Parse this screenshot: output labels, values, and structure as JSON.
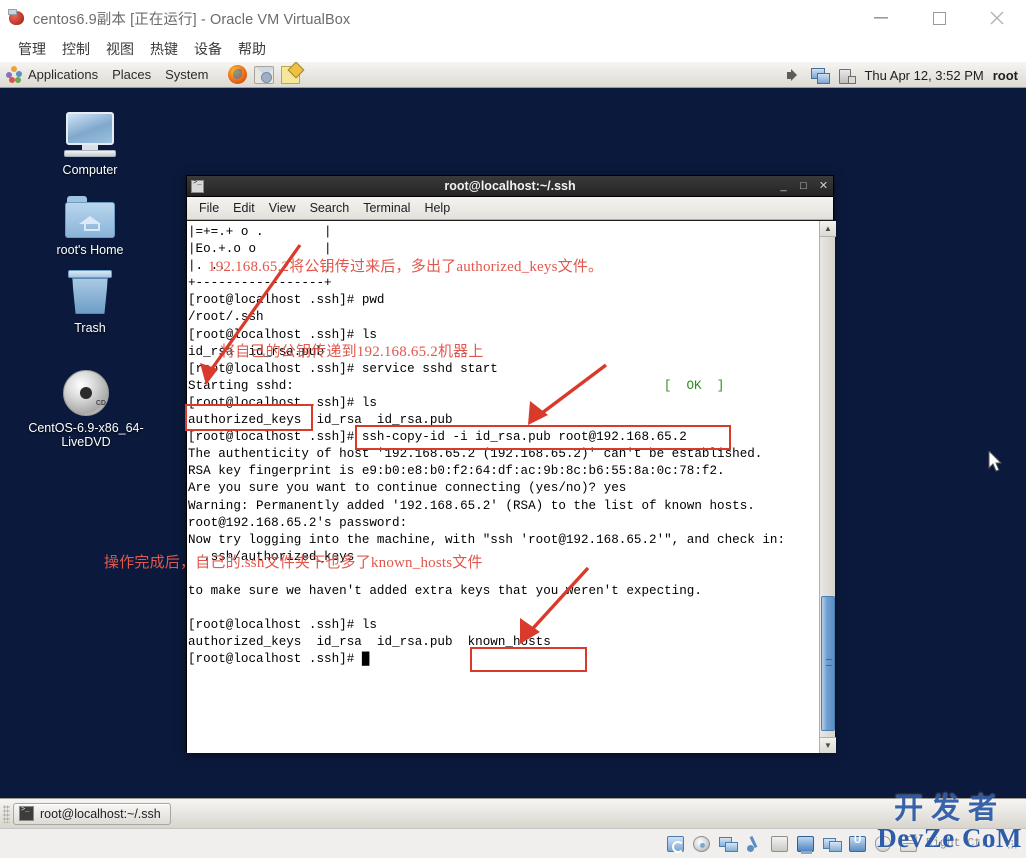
{
  "vbox": {
    "title": "centos6.9副本 [正在运行] - Oracle VM VirtualBox",
    "app_icon": "virtualbox-icon",
    "window_controls": [
      {
        "name": "minimize-button",
        "glyph": "—"
      },
      {
        "name": "maximize-button",
        "glyph": "□"
      },
      {
        "name": "close-button",
        "glyph": "✕"
      }
    ],
    "menus": [
      "管理",
      "控制",
      "视图",
      "热键",
      "设备",
      "帮助"
    ],
    "statusbar": {
      "icons": [
        "hard-disk-icon",
        "optical-disk-icon",
        "network-icon",
        "usb-icon",
        "shared-folder-icon",
        "display-icon",
        "window-capture-icon",
        "cpu-icon",
        "mouse-icon",
        "keyboard-icon"
      ],
      "host_key": "Right Ctrl"
    }
  },
  "guest_panel": {
    "menus": [
      "Applications",
      "Places",
      "System"
    ],
    "launchers": [
      "firefox-icon",
      "evolution-icon",
      "notes-icon"
    ],
    "tray": [
      "volume-icon",
      "network-icon",
      "battery-icon"
    ],
    "clock": "Thu Apr 12,  3:52 PM",
    "user": "root"
  },
  "desktop": {
    "icons": [
      {
        "label": "Computer",
        "icon": "computer-icon"
      },
      {
        "label": "root's Home",
        "icon": "home-folder-icon"
      },
      {
        "label": "Trash",
        "icon": "trash-icon"
      },
      {
        "label": "CentOS-6.9-x86_64-LiveDVD",
        "icon": "optical-disc-icon"
      }
    ]
  },
  "taskbar": {
    "buttons": [
      {
        "label": "root@localhost:~/.ssh",
        "icon": "terminal-icon"
      }
    ]
  },
  "terminal": {
    "title": "root@localhost:~/.ssh",
    "icon": "terminal-icon",
    "window_controls": [
      {
        "name": "minimize-button",
        "glyph": "_"
      },
      {
        "name": "maximize-button",
        "glyph": "□"
      },
      {
        "name": "close-button",
        "glyph": "✕"
      }
    ],
    "menus": [
      "File",
      "Edit",
      "View",
      "Search",
      "Terminal",
      "Help"
    ],
    "lines": [
      "|=+=.+ o .        |",
      "|Eo.+.o o         |",
      "|. ..             |",
      "+-----------------+",
      "[root@localhost .ssh]# pwd",
      "/root/.ssh",
      "[root@localhost .ssh]# ls",
      "id_rsa  id_rsa.pub",
      "[root@localhost .ssh]# service sshd start",
      "Starting sshd:",
      "[root@localhost .ssh]# ls",
      "authorized_keys  id_rsa  id_rsa.pub",
      "[root@localhost .ssh]# ssh-copy-id -i id_rsa.pub root@192.168.65.2",
      "The authenticity of host '192.168.65.2 (192.168.65.2)' can't be established.",
      "RSA key fingerprint is e9:b0:e8:b0:f2:64:df:ac:9b:8c:b6:55:8a:0c:78:f2.",
      "Are you sure you want to continue connecting (yes/no)? yes",
      "Warning: Permanently added '192.168.65.2' (RSA) to the list of known hosts.",
      "root@192.168.65.2's password:",
      "Now try logging into the machine, with \"ssh 'root@192.168.65.2'\", and check in:",
      "  .ssh/authorized_keys",
      "",
      "to make sure we haven't added extra keys that you weren't expecting.",
      "",
      "[root@localhost .ssh]# ls",
      "authorized_keys  id_rsa  id_rsa.pub  known_hosts",
      "[root@localhost .ssh]# "
    ],
    "ok_status": "[  OK  ]",
    "ok_color": "#2e8b1f",
    "cursor_block": "█"
  },
  "annotations": {
    "accent_color": "#e2574c",
    "box_color": "#d93a2b",
    "notes": [
      "192.168.65.2将公钥传过来后，多出了authorized_keys文件。",
      "将自己的公钥传递到192.168.65.2机器上",
      "操作完成后，自己的.ssh文件夹下也多了known_hosts文件"
    ],
    "boxes": [
      "authorized_keys",
      "ssh-copy-id -i id_rsa.pub root@192.168.65.2",
      "known_hosts"
    ]
  },
  "watermark": {
    "cn": "开发者",
    "en": "DevZe CoM",
    "color": "#2f5ca8"
  }
}
